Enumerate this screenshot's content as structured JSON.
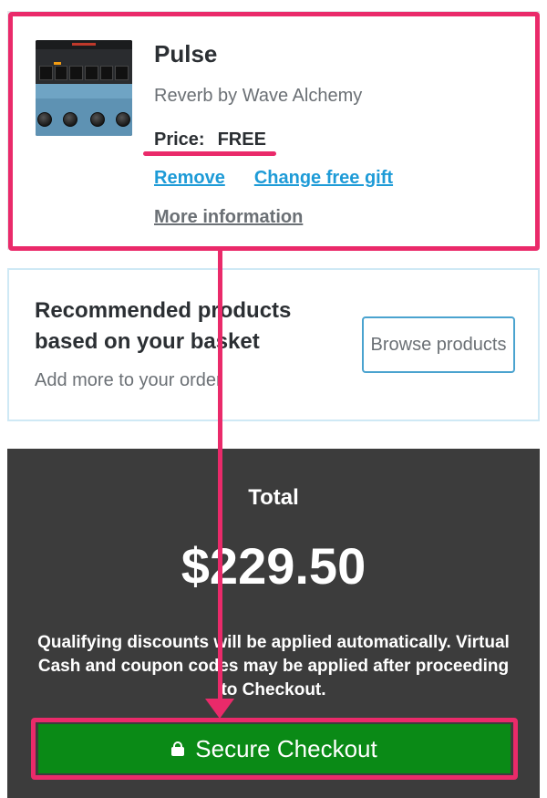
{
  "product": {
    "title": "Pulse",
    "subtitle": "Reverb by Wave Alchemy",
    "price_label": "Price:",
    "price_value": "FREE",
    "remove_link": "Remove",
    "change_gift_link": "Change free gift",
    "more_info_link": "More information"
  },
  "recommended": {
    "title": "Recommended products based on your basket",
    "subtitle": "Add more to your order",
    "browse_button": "Browse products"
  },
  "total": {
    "label": "Total",
    "amount": "$229.50",
    "note": "Qualifying discounts will be applied automatically. Virtual Cash and coupon codes may be applied after proceeding to Checkout.",
    "checkout_button": "Secure Checkout"
  },
  "colors": {
    "highlight": "#ea2a6a",
    "link": "#1e9bd7",
    "checkout_green": "#0a8a16",
    "total_bg": "#3c3c3c"
  },
  "icons": {
    "checkout": "lock-icon"
  }
}
